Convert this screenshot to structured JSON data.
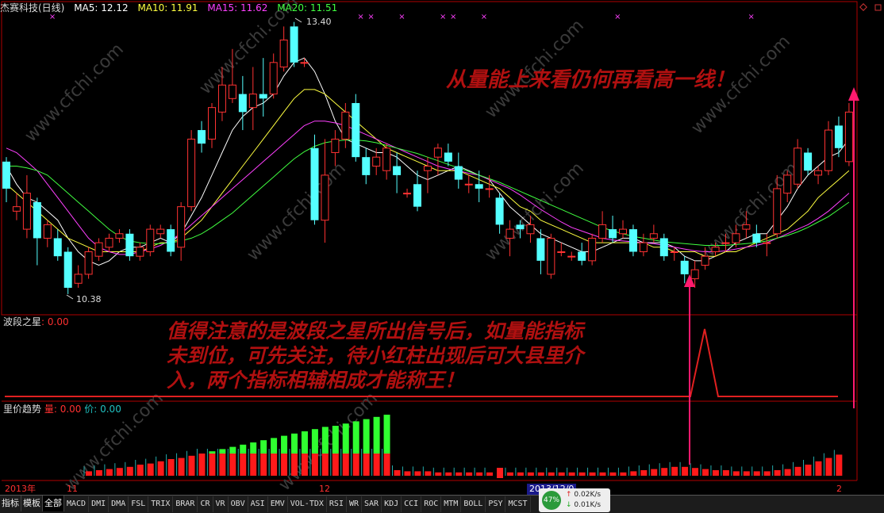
{
  "header": {
    "stock": "杰赛科技(日线)",
    "ma5_label": "MA5: 12.12",
    "ma10_label": "MA10: 11.91",
    "ma15_label": "MA15: 11.62",
    "ma20_label": "MA20: 11.51"
  },
  "annotations": {
    "top_note": "从量能上来看仍何再看高一线！",
    "mid_note_line1": "值得注意的是波段之星所出信号后，如量能指标",
    "mid_note_line2": "未到位，可先关注，待小红柱出现后可大县里介",
    "mid_note_line3": "入，两个指标相辅相成才能称王！",
    "high_label": "13.40",
    "low_label": "10.38"
  },
  "panels": {
    "wave_star": {
      "name": "波段之星",
      "value": ": 0.00"
    },
    "volume_trend": {
      "name": "里价趋势",
      "vol": "量: 0.00",
      "price": "价: 0.00"
    }
  },
  "dates": {
    "d1": "2013年",
    "d2": "11",
    "d3": "12",
    "d4": "2013/12/0",
    "d5": "2"
  },
  "toolbar": {
    "tabs": [
      "指标",
      "模板",
      "全部"
    ],
    "indicators": [
      "MACD",
      "DMI",
      "DMA",
      "FSL",
      "TRIX",
      "BRAR",
      "CR",
      "VR",
      "OBV",
      "ASI",
      "EMV",
      "VOL-TDX",
      "RSI",
      "WR",
      "SAR",
      "KDJ",
      "CCI",
      "ROC",
      "MTM",
      "BOLL",
      "PSY",
      "MCST"
    ]
  },
  "status": {
    "percent": "47%",
    "up": "0.02K/s",
    "down": "0.01K/s"
  },
  "watermark": "www.cfchi.com",
  "chart_data": {
    "type": "candlestick",
    "hi": 13.4,
    "lo": 10.38,
    "candles": [
      {
        "o": 11.85,
        "c": 11.55,
        "h": 11.9,
        "l": 11.4
      },
      {
        "o": 11.3,
        "c": 11.35,
        "h": 11.5,
        "l": 11.2
      },
      {
        "o": 11.1,
        "c": 11.5,
        "h": 11.7,
        "l": 11.0
      },
      {
        "o": 11.4,
        "c": 11.0,
        "h": 11.45,
        "l": 10.7
      },
      {
        "o": 11.0,
        "c": 11.15,
        "h": 11.2,
        "l": 10.9
      },
      {
        "o": 11.0,
        "c": 10.8,
        "h": 11.1,
        "l": 10.75
      },
      {
        "o": 10.85,
        "c": 10.45,
        "h": 10.9,
        "l": 10.38
      },
      {
        "o": 10.5,
        "c": 10.6,
        "h": 10.7,
        "l": 10.45
      },
      {
        "o": 10.6,
        "c": 10.85,
        "h": 10.9,
        "l": 10.55
      },
      {
        "o": 10.8,
        "c": 10.95,
        "h": 11.0,
        "l": 10.75
      },
      {
        "o": 10.9,
        "c": 11.0,
        "h": 11.05,
        "l": 10.85
      },
      {
        "o": 11.0,
        "c": 11.05,
        "h": 11.1,
        "l": 10.95
      },
      {
        "o": 11.05,
        "c": 10.8,
        "h": 11.1,
        "l": 10.75
      },
      {
        "o": 10.8,
        "c": 10.9,
        "h": 10.95,
        "l": 10.75
      },
      {
        "o": 10.85,
        "c": 11.1,
        "h": 11.15,
        "l": 10.8
      },
      {
        "o": 11.05,
        "c": 11.1,
        "h": 11.15,
        "l": 11.0
      },
      {
        "o": 11.1,
        "c": 10.85,
        "h": 11.15,
        "l": 10.8
      },
      {
        "o": 10.9,
        "c": 11.35,
        "h": 11.4,
        "l": 10.75
      },
      {
        "o": 11.35,
        "c": 12.1,
        "h": 12.2,
        "l": 11.3
      },
      {
        "o": 12.2,
        "c": 12.05,
        "h": 12.3,
        "l": 11.95
      },
      {
        "o": 12.1,
        "c": 12.45,
        "h": 12.5,
        "l": 12.0
      },
      {
        "o": 12.4,
        "c": 12.7,
        "h": 12.9,
        "l": 12.3
      },
      {
        "o": 12.55,
        "c": 12.7,
        "h": 13.1,
        "l": 12.5
      },
      {
        "o": 12.6,
        "c": 12.4,
        "h": 12.8,
        "l": 12.2
      },
      {
        "o": 12.45,
        "c": 12.6,
        "h": 12.9,
        "l": 12.2
      },
      {
        "o": 12.6,
        "c": 12.55,
        "h": 13.0,
        "l": 12.35
      },
      {
        "o": 12.6,
        "c": 12.95,
        "h": 13.05,
        "l": 12.55
      },
      {
        "o": 12.9,
        "c": 13.2,
        "h": 13.35,
        "l": 12.85
      },
      {
        "o": 13.35,
        "c": 12.95,
        "h": 13.4,
        "l": 12.9
      },
      {
        "o": 12.95,
        "c": 12.95,
        "h": 13.0,
        "l": 12.9
      },
      {
        "o": 12.0,
        "c": 11.2,
        "h": 12.15,
        "l": 11.15
      },
      {
        "o": 11.2,
        "c": 11.7,
        "h": 12.1,
        "l": 10.95
      },
      {
        "o": 11.95,
        "c": 12.1,
        "h": 12.2,
        "l": 11.8
      },
      {
        "o": 12.1,
        "c": 12.4,
        "h": 12.5,
        "l": 12.0
      },
      {
        "o": 12.5,
        "c": 11.9,
        "h": 12.6,
        "l": 11.85
      },
      {
        "o": 11.9,
        "c": 11.7,
        "h": 12.0,
        "l": 11.6
      },
      {
        "o": 11.8,
        "c": 11.9,
        "h": 12.0,
        "l": 11.7
      },
      {
        "o": 11.75,
        "c": 12.0,
        "h": 12.05,
        "l": 11.65
      },
      {
        "o": 11.8,
        "c": 11.7,
        "h": 11.95,
        "l": 11.5
      },
      {
        "o": 11.5,
        "c": 11.5,
        "h": 11.55,
        "l": 11.45
      },
      {
        "o": 11.6,
        "c": 11.35,
        "h": 11.75,
        "l": 11.3
      },
      {
        "o": 11.75,
        "c": 11.8,
        "h": 11.9,
        "l": 11.5
      },
      {
        "o": 11.9,
        "c": 12.0,
        "h": 12.05,
        "l": 11.7
      },
      {
        "o": 11.95,
        "c": 11.85,
        "h": 12.05,
        "l": 11.8
      },
      {
        "o": 11.8,
        "c": 11.65,
        "h": 11.95,
        "l": 11.55
      },
      {
        "o": 11.6,
        "c": 11.6,
        "h": 11.7,
        "l": 11.5
      },
      {
        "o": 11.6,
        "c": 11.55,
        "h": 11.75,
        "l": 11.4
      },
      {
        "o": 11.55,
        "c": 11.55,
        "h": 11.7,
        "l": 11.45
      },
      {
        "o": 11.45,
        "c": 11.15,
        "h": 11.5,
        "l": 11.05
      },
      {
        "o": 11.0,
        "c": 11.1,
        "h": 11.2,
        "l": 10.8
      },
      {
        "o": 11.15,
        "c": 11.1,
        "h": 11.2,
        "l": 11.0
      },
      {
        "o": 11.05,
        "c": 11.15,
        "h": 11.25,
        "l": 10.95
      },
      {
        "o": 11.0,
        "c": 10.75,
        "h": 11.1,
        "l": 10.6
      },
      {
        "o": 10.6,
        "c": 11.0,
        "h": 11.05,
        "l": 10.55
      },
      {
        "o": 10.85,
        "c": 10.85,
        "h": 10.95,
        "l": 10.8
      },
      {
        "o": 10.8,
        "c": 10.8,
        "h": 10.85,
        "l": 10.75
      },
      {
        "o": 10.85,
        "c": 10.75,
        "h": 10.95,
        "l": 10.7
      },
      {
        "o": 10.75,
        "c": 11.0,
        "h": 11.05,
        "l": 10.7
      },
      {
        "o": 11.0,
        "c": 11.15,
        "h": 11.3,
        "l": 10.95
      },
      {
        "o": 11.1,
        "c": 11.0,
        "h": 11.25,
        "l": 10.95
      },
      {
        "o": 11.05,
        "c": 11.1,
        "h": 11.2,
        "l": 11.0
      },
      {
        "o": 11.1,
        "c": 10.85,
        "h": 11.15,
        "l": 10.8
      },
      {
        "o": 10.85,
        "c": 10.95,
        "h": 11.05,
        "l": 10.8
      },
      {
        "o": 11.0,
        "c": 11.05,
        "h": 11.15,
        "l": 10.95
      },
      {
        "o": 11.0,
        "c": 10.8,
        "h": 11.05,
        "l": 10.75
      },
      {
        "o": 10.85,
        "c": 10.85,
        "h": 10.9,
        "l": 10.75
      },
      {
        "o": 10.75,
        "c": 10.6,
        "h": 10.8,
        "l": 10.5
      },
      {
        "o": 10.55,
        "c": 10.65,
        "h": 10.75,
        "l": 10.45
      },
      {
        "o": 10.7,
        "c": 10.8,
        "h": 10.9,
        "l": 10.65
      },
      {
        "o": 10.85,
        "c": 10.9,
        "h": 10.95,
        "l": 10.8
      },
      {
        "o": 10.95,
        "c": 10.95,
        "h": 11.05,
        "l": 10.85
      },
      {
        "o": 10.95,
        "c": 11.05,
        "h": 11.15,
        "l": 10.9
      },
      {
        "o": 11.1,
        "c": 11.15,
        "h": 11.3,
        "l": 11.0
      },
      {
        "o": 11.05,
        "c": 10.95,
        "h": 11.15,
        "l": 10.9
      },
      {
        "o": 10.95,
        "c": 10.95,
        "h": 11.05,
        "l": 10.8
      },
      {
        "o": 11.05,
        "c": 11.55,
        "h": 11.7,
        "l": 11.0
      },
      {
        "o": 11.5,
        "c": 11.7,
        "h": 11.75,
        "l": 11.4
      },
      {
        "o": 11.6,
        "c": 12.0,
        "h": 12.1,
        "l": 11.55
      },
      {
        "o": 11.95,
        "c": 11.75,
        "h": 12.0,
        "l": 11.7
      },
      {
        "o": 11.7,
        "c": 11.75,
        "h": 11.8,
        "l": 11.6
      },
      {
        "o": 11.75,
        "c": 12.2,
        "h": 12.3,
        "l": 11.7
      },
      {
        "o": 12.25,
        "c": 12.0,
        "h": 12.35,
        "l": 11.9
      },
      {
        "o": 11.85,
        "c": 12.4,
        "h": 12.5,
        "l": 11.8
      }
    ],
    "ma5": [
      11.8,
      11.6,
      11.45,
      11.4,
      11.3,
      11.2,
      11.0,
      10.85,
      10.75,
      10.7,
      10.75,
      10.85,
      10.9,
      10.9,
      10.95,
      11.0,
      10.95,
      11.05,
      11.25,
      11.45,
      11.7,
      11.95,
      12.2,
      12.35,
      12.45,
      12.5,
      12.6,
      12.8,
      12.95,
      13.0,
      12.85,
      12.6,
      12.3,
      12.1,
      12.05,
      12.0,
      11.95,
      11.95,
      11.9,
      11.8,
      11.7,
      11.65,
      11.7,
      11.75,
      11.8,
      11.75,
      11.7,
      11.65,
      11.5,
      11.35,
      11.25,
      11.15,
      11.05,
      11.0,
      10.95,
      10.9,
      10.85,
      10.85,
      10.9,
      10.95,
      11.0,
      11.0,
      10.95,
      10.95,
      10.95,
      10.9,
      10.8,
      10.75,
      10.75,
      10.8,
      10.85,
      10.95,
      11.0,
      11.05,
      11.05,
      11.2,
      11.35,
      11.55,
      11.7,
      11.8,
      11.9,
      11.95,
      12.1
    ],
    "ma10": [
      11.6,
      11.5,
      11.4,
      11.3,
      11.2,
      11.1,
      11.0,
      10.95,
      10.9,
      10.85,
      10.85,
      10.85,
      10.85,
      10.85,
      10.9,
      10.95,
      10.95,
      11.0,
      11.1,
      11.2,
      11.35,
      11.5,
      11.65,
      11.8,
      11.95,
      12.1,
      12.25,
      12.4,
      12.55,
      12.65,
      12.65,
      12.6,
      12.5,
      12.4,
      12.3,
      12.2,
      12.1,
      12.0,
      11.95,
      11.9,
      11.85,
      11.8,
      11.75,
      11.75,
      11.75,
      11.7,
      11.65,
      11.6,
      11.55,
      11.45,
      11.35,
      11.3,
      11.2,
      11.15,
      11.1,
      11.05,
      11.0,
      10.95,
      10.95,
      10.95,
      10.95,
      10.95,
      10.95,
      10.9,
      10.9,
      10.85,
      10.85,
      10.85,
      10.8,
      10.8,
      10.85,
      10.85,
      10.9,
      10.95,
      11.0,
      11.05,
      11.1,
      11.2,
      11.3,
      11.45,
      11.55,
      11.65,
      11.75
    ],
    "ma15": [
      12.0,
      11.95,
      11.85,
      11.75,
      11.6,
      11.45,
      11.3,
      11.15,
      11.0,
      10.9,
      10.85,
      10.82,
      10.82,
      10.85,
      10.88,
      10.92,
      10.98,
      11.05,
      11.15,
      11.25,
      11.35,
      11.45,
      11.55,
      11.65,
      11.75,
      11.85,
      11.95,
      12.05,
      12.15,
      12.25,
      12.3,
      12.3,
      12.28,
      12.25,
      12.2,
      12.15,
      12.1,
      12.05,
      12.0,
      11.95,
      11.9,
      11.85,
      11.8,
      11.77,
      11.75,
      11.72,
      11.7,
      11.65,
      11.6,
      11.55,
      11.48,
      11.4,
      11.32,
      11.25,
      11.18,
      11.12,
      11.08,
      11.04,
      11.0,
      10.98,
      10.97,
      10.96,
      10.95,
      10.94,
      10.92,
      10.9,
      10.88,
      10.86,
      10.85,
      10.85,
      10.86,
      10.88,
      10.9,
      10.92,
      10.95,
      11.0,
      11.05,
      11.1,
      11.15,
      11.22,
      11.3,
      11.4,
      11.5
    ],
    "ma20": [
      11.8,
      11.8,
      11.78,
      11.75,
      11.7,
      11.6,
      11.5,
      11.4,
      11.3,
      11.2,
      11.1,
      11.02,
      10.97,
      10.95,
      10.94,
      10.94,
      10.95,
      10.97,
      11.0,
      11.05,
      11.12,
      11.2,
      11.28,
      11.38,
      11.48,
      11.58,
      11.68,
      11.78,
      11.88,
      11.96,
      12.02,
      12.06,
      12.08,
      12.09,
      12.09,
      12.08,
      12.06,
      12.03,
      12.0,
      11.97,
      11.94,
      11.9,
      11.86,
      11.82,
      11.78,
      11.74,
      11.7,
      11.66,
      11.62,
      11.57,
      11.52,
      11.47,
      11.42,
      11.37,
      11.32,
      11.27,
      11.22,
      11.17,
      11.12,
      11.08,
      11.05,
      11.02,
      11.0,
      10.98,
      10.96,
      10.95,
      10.94,
      10.93,
      10.92,
      10.92,
      10.92,
      10.93,
      10.94,
      10.95,
      10.97,
      11.0,
      11.03,
      11.07,
      11.12,
      11.18,
      11.24,
      11.32,
      11.4
    ],
    "markers": [
      2,
      32,
      33,
      36,
      40,
      41,
      44,
      57,
      70
    ]
  },
  "volume_data": [
    0.4,
    0.5,
    0.6,
    0.7,
    0.8,
    1.0,
    1.1,
    1.3,
    1.5,
    1.6,
    1.8,
    2.0,
    2.2,
    2.4,
    2.6,
    2.8,
    3.0,
    3.2,
    3.4,
    3.6,
    3.8,
    4.0,
    4.2,
    4.4,
    4.5,
    4.7,
    4.9,
    5.1,
    5.3,
    5.5,
    0.5,
    0.4,
    0.4,
    0.4,
    0.3,
    0.3,
    0.3,
    0.3,
    0.3,
    0.3,
    -0.5,
    0.3,
    0.3,
    0.3,
    0.3,
    0.3,
    0.3,
    0.3,
    0.3,
    0.3,
    0.3,
    0.3,
    0.3,
    0.4,
    0.5,
    0.6,
    0.7,
    0.8,
    0.8,
    0.7,
    0.6,
    0.5,
    0.5,
    0.4,
    0.4,
    0.4,
    0.4,
    0.5,
    0.6,
    0.8,
    1.0,
    1.3,
    1.6,
    1.9,
    2.2,
    2.5,
    2.8,
    3.1,
    3.4,
    3.7,
    4.0,
    4.3,
    4.6,
    4.9,
    5.2
  ]
}
